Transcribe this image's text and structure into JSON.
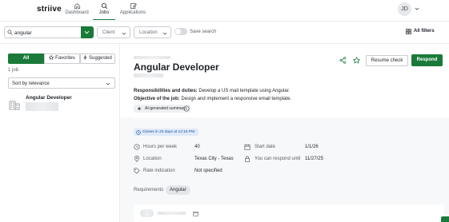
{
  "brand": {
    "logo": "striive"
  },
  "nav": {
    "items": [
      {
        "label": "Dashboard",
        "icon": "home-icon"
      },
      {
        "label": "Jobs",
        "icon": "search-icon"
      },
      {
        "label": "Applications",
        "icon": "edit-icon"
      }
    ],
    "active": "Jobs"
  },
  "user": {
    "initials": "JD"
  },
  "search": {
    "value": "angular",
    "client_label": "Client",
    "location_label": "Location",
    "save_search_label": "Save search",
    "all_filters_label": "All filters"
  },
  "left": {
    "tabs": [
      {
        "label": "All"
      },
      {
        "label": "Favorites"
      },
      {
        "label": "Suggested"
      }
    ],
    "active_tab": "All",
    "job_count": "1 job",
    "sort_label": "Sort by relevance",
    "jobs": [
      {
        "title": "Angular Developer"
      }
    ]
  },
  "detail": {
    "title": "Angular Developer",
    "resume_check_label": "Resume check",
    "respond_label": "Respond",
    "responsibilities_heading": "Responsibilities and duties:",
    "responsibilities_text": "Develop a US mail template using Angular.",
    "objective_heading": "Objective of the job:",
    "objective_text": "Design and implement a responsive email template.",
    "ai_summary_label": "AI-generated summary",
    "deadline_label": "Closes in 20 days at 12:16 PM",
    "rows": {
      "hours_label": "Hours per week",
      "hours_value": "40",
      "start_label": "Start date",
      "start_value": "1/1/26",
      "location_label": "Location",
      "location_value": "Texas City - Texas",
      "respond_until_label": "You can respond until",
      "respond_until_value": "11/27/25",
      "rate_label": "Rate indication",
      "rate_value": "Not specified"
    },
    "requirements_label": "Requirements",
    "requirements": [
      "Angular"
    ]
  },
  "colors": {
    "accent": "#1a7a3a",
    "deadline_bg": "#dfeafa",
    "deadline_text": "#1d4f91"
  }
}
